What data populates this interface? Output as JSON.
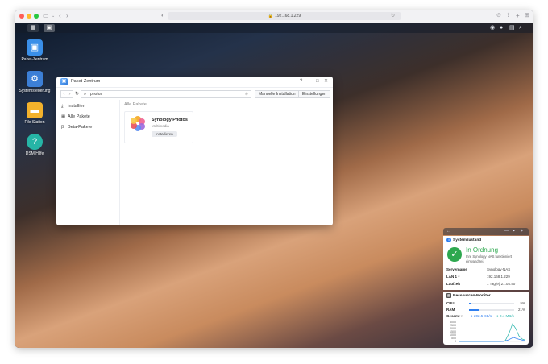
{
  "browser": {
    "url": "192.168.1.229",
    "traffic_colors": {
      "close": "#ff5f57",
      "min": "#febc2e",
      "max": "#28c840"
    }
  },
  "desktop_icons": [
    {
      "label": "Paket-Zentrum",
      "icon": "package-center-icon",
      "color": "#3a8fe8"
    },
    {
      "label": "Systemsteuerung",
      "icon": "control-panel-icon",
      "color": "#3c7fd6"
    },
    {
      "label": "File Station",
      "icon": "folder-icon",
      "color": "#f3b22c"
    },
    {
      "label": "DSM Hilfe",
      "icon": "help-icon",
      "color": "#26b5a6"
    }
  ],
  "window": {
    "title": "Paket-Zentrum",
    "search_value": "photos",
    "manual_install_label": "Manuelle Installation",
    "settings_label": "Einstellungen",
    "help_glyph": "?",
    "nav": [
      {
        "label": "Installiert",
        "icon": "download-icon"
      },
      {
        "label": "Alle Pakete",
        "icon": "grid-icon"
      },
      {
        "label": "Beta-Pakete",
        "icon": "beta-icon"
      }
    ],
    "section_title": "Alle Pakete",
    "package": {
      "name": "Synology Photos",
      "category": "Multimedia",
      "button": "Installieren"
    }
  },
  "widget": {
    "system_health": {
      "title": "Systemzustand",
      "status": "In Ordnung",
      "description": "Ihre Synology NAS funktioniert einwandfrei.",
      "rows": [
        {
          "key": "Servername",
          "value": "Synology-NAS"
        },
        {
          "key": "LAN 1",
          "value": "192.168.1.229",
          "dropdown": "▾"
        },
        {
          "key": "Laufzeit",
          "value": "1 Tag(e) 21:04:40"
        }
      ],
      "accent": "#2ea84f"
    },
    "resource_monitor": {
      "title": "Ressourcen-Monitor",
      "cpu_label": "CPU",
      "cpu_percent": 5,
      "cpu_text": "5%",
      "ram_label": "RAM",
      "ram_percent": 21,
      "ram_text": "21%",
      "total_label": "Gesamt",
      "upload": "202.5 KB/s",
      "download": "2.4 MB/s",
      "y_ticks": [
        "3000",
        "2500",
        "2000",
        "1500",
        "1000",
        "500",
        "0"
      ],
      "colors": {
        "up": "#2f7ff0",
        "down": "#22b2a8"
      }
    }
  }
}
